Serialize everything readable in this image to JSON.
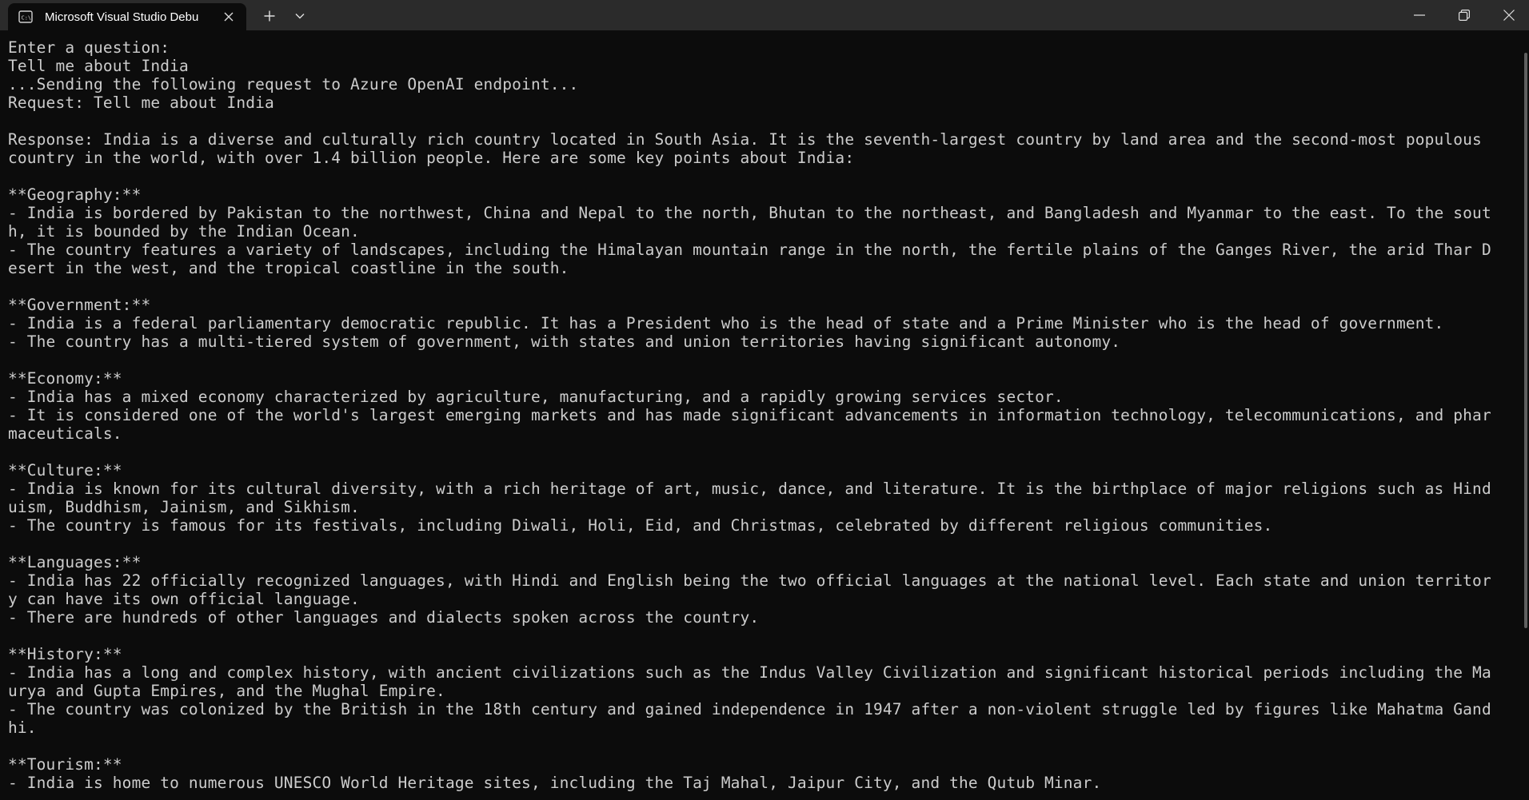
{
  "window": {
    "tab_title": "Microsoft Visual Studio Debu",
    "tab_icon": "console-icon",
    "controls": [
      "minimize-icon",
      "restore-icon",
      "close-icon"
    ]
  },
  "console": {
    "lines": [
      "Enter a question:",
      "Tell me about India",
      "...Sending the following request to Azure OpenAI endpoint...",
      "Request: Tell me about India",
      "",
      "Response: India is a diverse and culturally rich country located in South Asia. It is the seventh-largest country by land area and the second-most populous",
      "country in the world, with over 1.4 billion people. Here are some key points about India:",
      "",
      "**Geography:**",
      "- India is bordered by Pakistan to the northwest, China and Nepal to the north, Bhutan to the northeast, and Bangladesh and Myanmar to the east. To the sout",
      "h, it is bounded by the Indian Ocean.",
      "- The country features a variety of landscapes, including the Himalayan mountain range in the north, the fertile plains of the Ganges River, the arid Thar D",
      "esert in the west, and the tropical coastline in the south.",
      "",
      "**Government:**",
      "- India is a federal parliamentary democratic republic. It has a President who is the head of state and a Prime Minister who is the head of government.",
      "- The country has a multi-tiered system of government, with states and union territories having significant autonomy.",
      "",
      "**Economy:**",
      "- India has a mixed economy characterized by agriculture, manufacturing, and a rapidly growing services sector.",
      "- It is considered one of the world's largest emerging markets and has made significant advancements in information technology, telecommunications, and phar",
      "maceuticals.",
      "",
      "**Culture:**",
      "- India is known for its cultural diversity, with a rich heritage of art, music, dance, and literature. It is the birthplace of major religions such as Hind",
      "uism, Buddhism, Jainism, and Sikhism.",
      "- The country is famous for its festivals, including Diwali, Holi, Eid, and Christmas, celebrated by different religious communities.",
      "",
      "**Languages:**",
      "- India has 22 officially recognized languages, with Hindi and English being the two official languages at the national level. Each state and union territor",
      "y can have its own official language.",
      "- There are hundreds of other languages and dialects spoken across the country.",
      "",
      "**History:**",
      "- India has a long and complex history, with ancient civilizations such as the Indus Valley Civilization and significant historical periods including the Ma",
      "urya and Gupta Empires, and the Mughal Empire.",
      "- The country was colonized by the British in the 18th century and gained independence in 1947 after a non-violent struggle led by figures like Mahatma Gand",
      "hi.",
      "",
      "**Tourism:**",
      "- India is home to numerous UNESCO World Heritage sites, including the Taj Mahal, Jaipur City, and the Qutub Minar."
    ]
  }
}
